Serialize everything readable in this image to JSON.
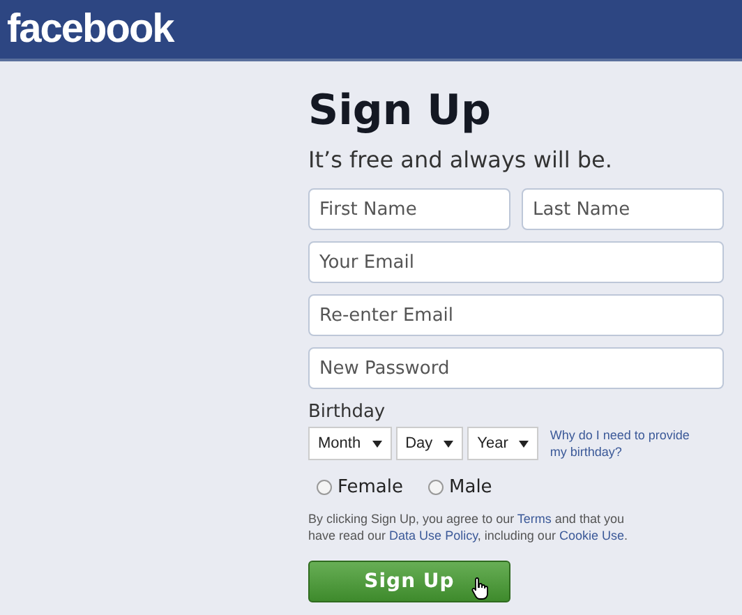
{
  "header": {
    "logo": "facebook"
  },
  "title": "Sign Up",
  "subtitle": "It’s free and always will be.",
  "name_fields": [
    {
      "placeholder": "First Name"
    },
    {
      "placeholder": "Last Name"
    }
  ],
  "fields": [
    {
      "placeholder": "Your Email"
    },
    {
      "placeholder": "Re-enter Email"
    },
    {
      "placeholder": "New Password"
    }
  ],
  "birthday": {
    "label": "Birthday",
    "selects": [
      {
        "value": "Month"
      },
      {
        "value": "Day"
      },
      {
        "value": "Year"
      }
    ],
    "help_link": "Why do I need to provide my birthday?"
  },
  "gender": [
    {
      "label": "Female",
      "selected": false
    },
    {
      "label": "Male",
      "selected": false
    }
  ],
  "terms": [
    {
      "kind": "text",
      "text": "By clicking Sign Up, you agree to our "
    },
    {
      "kind": "link",
      "text": "Terms"
    },
    {
      "kind": "text",
      "text": " and that you have read our "
    },
    {
      "kind": "link",
      "text": "Data Use Policy"
    },
    {
      "kind": "text",
      "text": ", including our "
    },
    {
      "kind": "link",
      "text": "Cookie Use"
    },
    {
      "kind": "text",
      "text": "."
    }
  ],
  "submit": "Sign Up"
}
